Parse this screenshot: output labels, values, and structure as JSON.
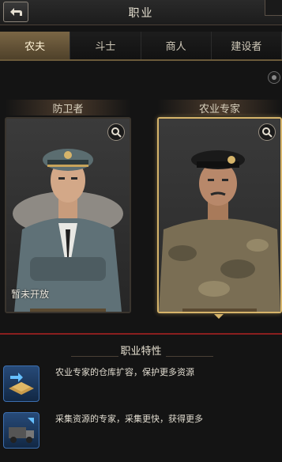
{
  "header": {
    "title": "职业"
  },
  "tabs": [
    {
      "label": "农夫",
      "active": true
    },
    {
      "label": "斗士",
      "active": false
    },
    {
      "label": "商人",
      "active": false
    },
    {
      "label": "建设者",
      "active": false
    }
  ],
  "cards": [
    {
      "label": "防卫者",
      "status": "暂未开放",
      "selected": false
    },
    {
      "label": "农业专家",
      "selected": true
    }
  ],
  "traits": {
    "title": "职业特性",
    "items": [
      {
        "icon": "warehouse-expand-icon",
        "text": "农业专家的仓库扩容，保护更多资源"
      },
      {
        "icon": "gathering-truck-icon",
        "text": "采集资源的专家，采集更快，获得更多"
      }
    ]
  },
  "colors": {
    "accent": "#d6b46a",
    "tab_active": "#7a6645",
    "divider": "#8a1e1e"
  }
}
